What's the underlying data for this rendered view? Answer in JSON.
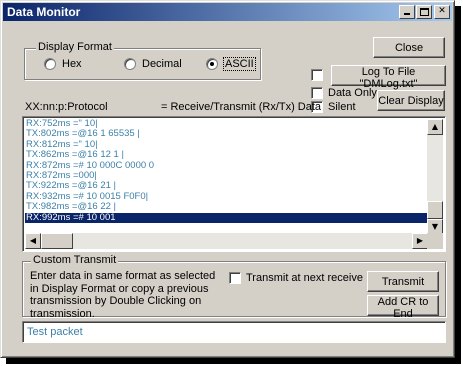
{
  "window": {
    "title": "Data Monitor"
  },
  "display_format": {
    "legend": "Display Format",
    "options": [
      {
        "label": "Hex",
        "selected": false
      },
      {
        "label": "Decimal",
        "selected": false
      },
      {
        "label": "ASCII",
        "selected": true
      }
    ]
  },
  "buttons": {
    "close": "Close",
    "log": "Log To File \"DMLog.txt\"",
    "clear": "Clear Display",
    "transmit": "Transmit",
    "add_cr": "Add CR to End"
  },
  "checkboxes": {
    "log": {
      "checked": false
    },
    "data_only": {
      "label": "Data Only",
      "checked": false
    },
    "silent": {
      "label": "Silent",
      "checked": false
    },
    "transmit_next": {
      "label": "Transmit at next receive",
      "checked": false
    }
  },
  "header": {
    "left": "XX:nn:p:Protocol",
    "right": "= Receive/Transmit (Rx/Tx) Data"
  },
  "log_lines": [
    "RX:752ms =\" 10|",
    "TX:802ms =@16 1 65535 |",
    "RX:812ms =\" 10|",
    "TX:862ms =@16 12 1 |",
    "RX:872ms =# 10 000C 0000 0",
    "RX:872ms =000|",
    "TX:922ms =@16 21 |",
    "RX:932ms =# 10 0015 F0F0|",
    "TX:982ms =@16 22 |",
    "RX:992ms =# 10 001"
  ],
  "selected_line_index": 9,
  "custom_transmit": {
    "legend": "Custom Transmit",
    "description": "Enter data in same format as selected in Display Format or copy a previous transmission by Double Clicking on transmission.",
    "value": "Test packet"
  },
  "colors": {
    "titlebar": "#0a246a",
    "text_blue": "#3c80a8",
    "selection": "#0a246a"
  }
}
